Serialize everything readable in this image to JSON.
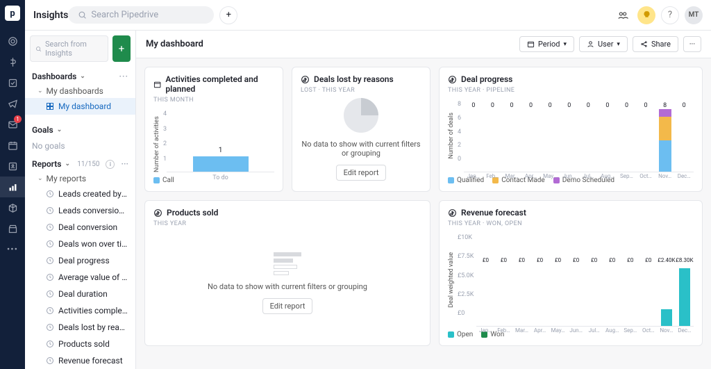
{
  "app_title": "Insights",
  "search_placeholder": "Search Pipedrive",
  "avatar_initials": "MT",
  "sidebar": {
    "search_placeholder": "Search from Insights",
    "dashboards_label": "Dashboards",
    "my_dashboards_label": "My dashboards",
    "my_dashboard_label": "My dashboard",
    "goals_label": "Goals",
    "no_goals_label": "No goals",
    "reports_label": "Reports",
    "reports_count": "11/150",
    "my_reports_label": "My reports",
    "reports": [
      "Leads created by users",
      "Leads conversion by so…",
      "Deal conversion",
      "Deals won over time",
      "Deal progress",
      "Average value of won d…",
      "Deal duration",
      "Activities completed an…",
      "Deals lost by reasons",
      "Products sold",
      "Revenue forecast"
    ]
  },
  "dashboard": {
    "title": "My dashboard",
    "period_btn": "Period",
    "user_btn": "User",
    "share_btn": "Share"
  },
  "cards": {
    "activities": {
      "title": "Activities completed and planned",
      "sub": "THIS MONTH",
      "ylabel": "Number of activities",
      "legend_call": "Call",
      "value_label": "1",
      "xlabel": "To do"
    },
    "lost": {
      "title": "Deals lost by reasons",
      "sub": "LOST  ·  THIS YEAR",
      "nodata": "No data to show with current filters or grouping",
      "edit": "Edit report"
    },
    "progress": {
      "title": "Deal progress",
      "sub": "THIS YEAR  ·  PIPELINE",
      "ylabel": "Number of deals",
      "legend": [
        "Qualified",
        "Contact Made",
        "Demo Scheduled"
      ]
    },
    "products": {
      "title": "Products sold",
      "sub": "THIS YEAR",
      "nodata": "No data to show with current filters or grouping",
      "edit": "Edit report"
    },
    "revenue": {
      "title": "Revenue forecast",
      "sub": "THIS YEAR  ·  WON, OPEN",
      "ylabel": "Deal weighted value",
      "legend": [
        "Open",
        "Won"
      ]
    }
  },
  "chart_data": [
    {
      "type": "bar",
      "for": "activities",
      "categories": [
        "To do"
      ],
      "values": [
        1
      ],
      "ylabel": "Number of activities",
      "ylim": [
        0,
        4
      ],
      "yticks": [
        1,
        2,
        3,
        4
      ],
      "series_name": "Call"
    },
    {
      "type": "bar",
      "for": "deal_progress",
      "categories": [
        "Jan…",
        "Feb…",
        "Mar…",
        "Apr…",
        "May…",
        "Jun…",
        "Jul…",
        "Aug…",
        "Sep…",
        "Oct…",
        "Nov…",
        "Dec…"
      ],
      "series": [
        {
          "name": "Qualified",
          "color": "#6cbef1",
          "values": [
            0,
            0,
            0,
            0,
            0,
            0,
            0,
            0,
            0,
            0,
            4,
            0
          ]
        },
        {
          "name": "Contact Made",
          "color": "#f3b94a",
          "values": [
            0,
            0,
            0,
            0,
            0,
            0,
            0,
            0,
            0,
            0,
            3,
            0
          ]
        },
        {
          "name": "Demo Scheduled",
          "color": "#b26bd4",
          "values": [
            0,
            0,
            0,
            0,
            0,
            0,
            0,
            0,
            0,
            0,
            1,
            0
          ]
        }
      ],
      "totals": [
        0,
        0,
        0,
        0,
        0,
        0,
        0,
        0,
        0,
        0,
        8,
        0
      ],
      "ylabel": "Number of deals",
      "ylim": [
        0,
        8
      ],
      "yticks": [
        0,
        2,
        4,
        6,
        8
      ]
    },
    {
      "type": "bar",
      "for": "revenue_forecast",
      "categories": [
        "Jan…",
        "Feb…",
        "Mar…",
        "Apr…",
        "May…",
        "Jun…",
        "Jul…",
        "Aug…",
        "Sep…",
        "Oct…",
        "Nov…",
        "Dec…"
      ],
      "labels": [
        "£0",
        "£0",
        "£0",
        "£0",
        "£0",
        "£0",
        "£0",
        "£0",
        "£0",
        "£0",
        "£2.40K",
        "£8.30K"
      ],
      "values": [
        0,
        0,
        0,
        0,
        0,
        0,
        0,
        0,
        0,
        0,
        2400,
        8300
      ],
      "series_name": "Open",
      "ylabel": "Deal weighted value",
      "ylim": [
        0,
        10000
      ],
      "yticks_labels": [
        "£0",
        "£2.5K",
        "£5.0K",
        "£7.5K",
        "£10K"
      ],
      "legend": [
        "Open",
        "Won"
      ]
    }
  ]
}
